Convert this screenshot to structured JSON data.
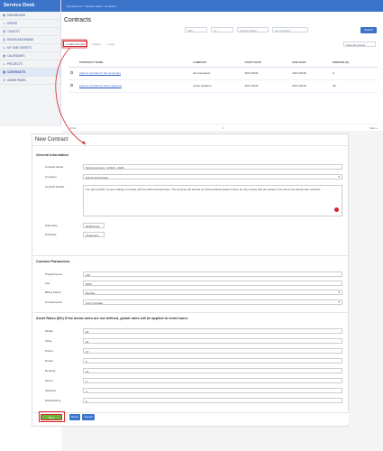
{
  "app": {
    "brand": "Service Desk"
  },
  "breadcrumb": "Dynamic Fox > Service Desk > Contracts",
  "sidebar": {
    "items": [
      {
        "label": "DASHBOARD",
        "icon": "dashboard-icon",
        "glyph": "▦"
      },
      {
        "label": "USERS",
        "icon": "users-icon",
        "glyph": "☺"
      },
      {
        "label": "TICKETS",
        "icon": "tickets-icon",
        "glyph": "▤"
      },
      {
        "label": "KNOWLEDGEBASE",
        "icon": "book-icon",
        "glyph": "▥"
      },
      {
        "label": "MY TIME SHEETS",
        "icon": "clock-icon",
        "glyph": "◷"
      },
      {
        "label": "CALENDARS",
        "icon": "calendar-icon",
        "glyph": "▦"
      },
      {
        "label": "PROJECTS",
        "icon": "folder-icon",
        "glyph": "▭"
      },
      {
        "label": "CONTRACTS",
        "icon": "contract-icon",
        "glyph": "▤"
      },
      {
        "label": "ADMIN PANEL",
        "icon": "gear-icon",
        "glyph": "⚙"
      }
    ],
    "active_index": 7
  },
  "list": {
    "title": "Contracts",
    "filters": {
      "start": "Start...",
      "end": "To...",
      "name": "Contract Name",
      "company": "Any Company",
      "search": "Search"
    },
    "toolbar": {
      "add": "Add Contract",
      "delete": "Delete",
      "copy": "Copy"
    },
    "per_page": "Show 20 records",
    "columns": [
      "CONTRACT NAME",
      "COMPANY",
      "START DATE",
      "END DATE",
      "PREPAID (H)"
    ],
    "rows": [
      {
        "name": "Autumn contract for Sw computers",
        "company": "Sw computers",
        "start": "2017-09-01",
        "end": "2017-09-30",
        "prepaid": "0"
      },
      {
        "name": "Autumn contract for Azure Systems",
        "company": "Azure Systems",
        "start": "2017-09-01",
        "end": "2017-09-30",
        "prepaid": "30"
      }
    ],
    "pager": {
      "prev": "« Prev",
      "page": "1",
      "next": "Next »"
    }
  },
  "form": {
    "title": "New Contract",
    "general_section": "General Information",
    "contract_name_label": "Contract Name",
    "contract_name": "Spring Contract - HiTech - 2018",
    "company_label": "Company",
    "company": "HiTech Enterprises",
    "details_label": "Contract Details",
    "details": "For spring 2018, we are making a contract with the HiTech Enterprises. The services will include for all the default assets if there are any issues with the assets in the future we will provide solutions.",
    "start_label": "Start Date",
    "start": "2018-01-01",
    "end_label": "End Date",
    "end": "(Unknown)",
    "params_section": "Contract Parameters",
    "prepaid_label": "Prepaid Hours",
    "prepaid": "100",
    "fee_label": "Fee",
    "fee": "5000",
    "billing_label": "Billing Period",
    "billing": "Monthly",
    "unused_label": "Unused Hours",
    "unused": "Carry Forward",
    "rates_section": "Asset Rates ($/h) If the below rates are not defined, global rates will be applied to extra hours.",
    "rates": [
      {
        "label": "Mobile",
        "value": "20"
      },
      {
        "label": "Other",
        "value": "20"
      },
      {
        "label": "Printer",
        "value": "10"
      },
      {
        "label": "Router",
        "value": "0"
      },
      {
        "label": "RouterQ",
        "value": "10"
      },
      {
        "label": "Server",
        "value": "0"
      },
      {
        "label": "Switches",
        "value": "0"
      },
      {
        "label": "Workstations",
        "value": "0"
      }
    ],
    "buttons": {
      "save": "Save",
      "reset": "Reset",
      "cancel": "Cancel"
    }
  }
}
